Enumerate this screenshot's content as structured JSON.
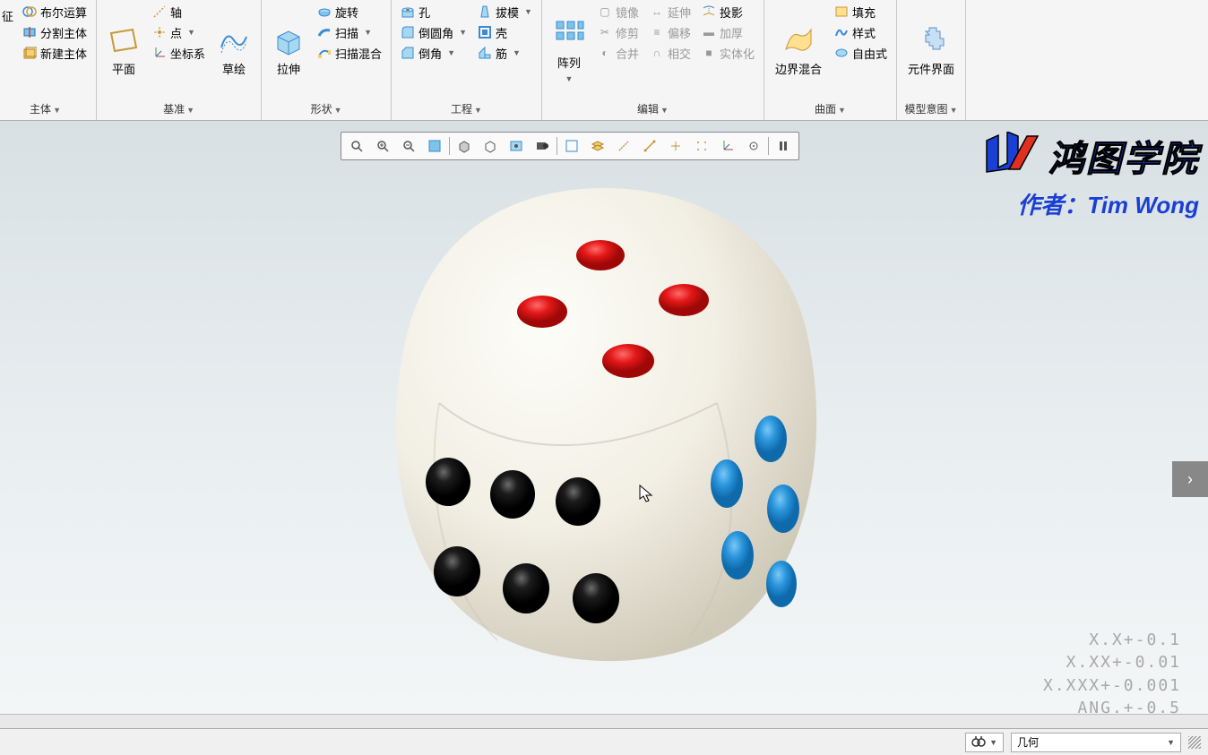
{
  "ribbon": {
    "groups": {
      "feature": {
        "label": "征",
        "items": [
          "布尔运算",
          "分割主体",
          "新建主体"
        ],
        "group_label": "主体"
      },
      "datum": {
        "plane": "平面",
        "axis": "轴",
        "point": "点",
        "csys": "坐标系",
        "sketch": "草绘",
        "group_label": "基准"
      },
      "shape": {
        "extrude": "拉伸",
        "revolve": "旋转",
        "sweep": "扫描",
        "sweep_blend": "扫描混合",
        "group_label": "形状"
      },
      "eng": {
        "hole": "孔",
        "round": "倒圆角",
        "chamfer": "倒角",
        "draft": "拔模",
        "shell": "壳",
        "rib": "筋",
        "group_label": "工程"
      },
      "edit": {
        "pattern": "阵列",
        "mirror": "镜像",
        "trim": "修剪",
        "merge": "合并",
        "extend": "延伸",
        "offset": "偏移",
        "intersect": "相交",
        "project": "投影",
        "thicken": "加厚",
        "solidify": "实体化",
        "group_label": "编辑"
      },
      "surface": {
        "boundary": "边界混合",
        "fill": "填充",
        "style": "样式",
        "freestyle": "自由式",
        "group_label": "曲面"
      },
      "intent": {
        "component": "元件界面",
        "group_label": "模型意图"
      }
    }
  },
  "watermark": {
    "title": "鸿图学院",
    "author": "作者：Tim Wong"
  },
  "tolerances": [
    "X.X+-0.1",
    "X.XX+-0.01",
    "X.XXX+-0.001",
    "ANG.+-0.5"
  ],
  "status": {
    "filter": "几何"
  },
  "mini_icons": [
    "zoom-fit",
    "zoom-in",
    "zoom-out",
    "refit",
    "pan",
    "spin",
    "view",
    "named",
    "saved",
    "layers",
    "annot",
    "datum-disp",
    "axis-disp",
    "point-disp",
    "csys-disp",
    "plane-disp",
    "pause"
  ]
}
